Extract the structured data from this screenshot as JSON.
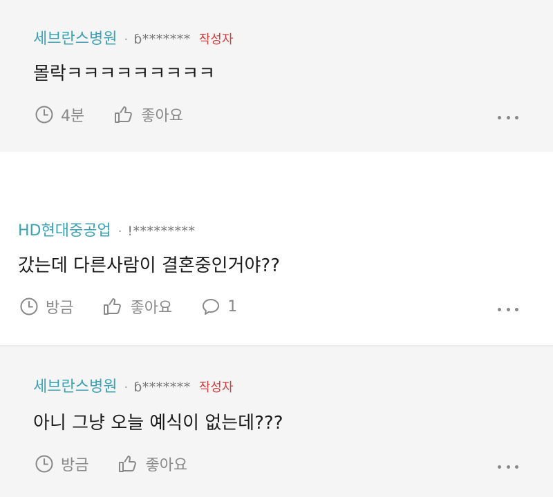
{
  "comments": [
    {
      "company": "세브란스병원",
      "sep": "·",
      "user": "ɓ*******",
      "author_badge": "작성자",
      "text": "몰락ㅋㅋㅋㅋㅋㅋㅋㅋㅋ",
      "time": "4분",
      "like": "좋아요"
    },
    {
      "company": "HD현대중공업",
      "sep": "·",
      "user": "!*********",
      "text": "갔는데 다른사람이 결혼중인거야??",
      "time": "방금",
      "like": "좋아요",
      "reply_count": "1"
    },
    {
      "company": "세브란스병원",
      "sep": "·",
      "user": "ɓ*******",
      "author_badge": "작성자",
      "text": "아니 그냥 오늘 예식이 없는데???",
      "time": "방금",
      "like": "좋아요"
    }
  ],
  "icons": [
    "clock-icon",
    "thumbs-up-icon",
    "speech-bubble-icon",
    "more-dots-icon"
  ]
}
